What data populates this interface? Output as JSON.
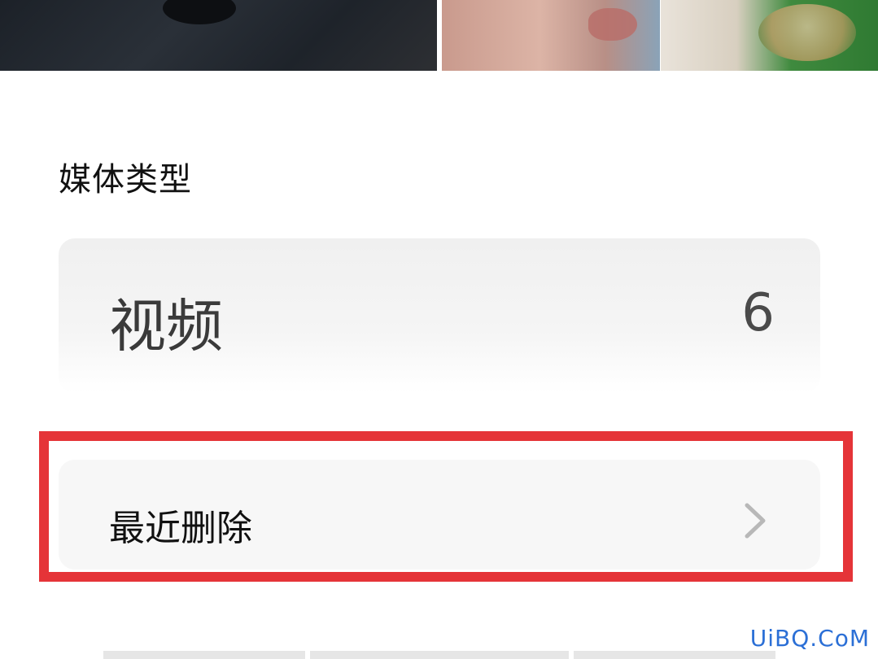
{
  "thumbnails": [
    {
      "name": "photo-thumbnail-1"
    },
    {
      "name": "photo-thumbnail-2"
    },
    {
      "name": "photo-thumbnail-3"
    }
  ],
  "section": {
    "title": "媒体类型"
  },
  "video_item": {
    "label": "视频",
    "count": "6"
  },
  "deleted_item": {
    "label": "最近删除",
    "icon": "chevron-right-icon"
  },
  "highlight_color": "#e53438",
  "watermark": "UiBQ.CoM"
}
